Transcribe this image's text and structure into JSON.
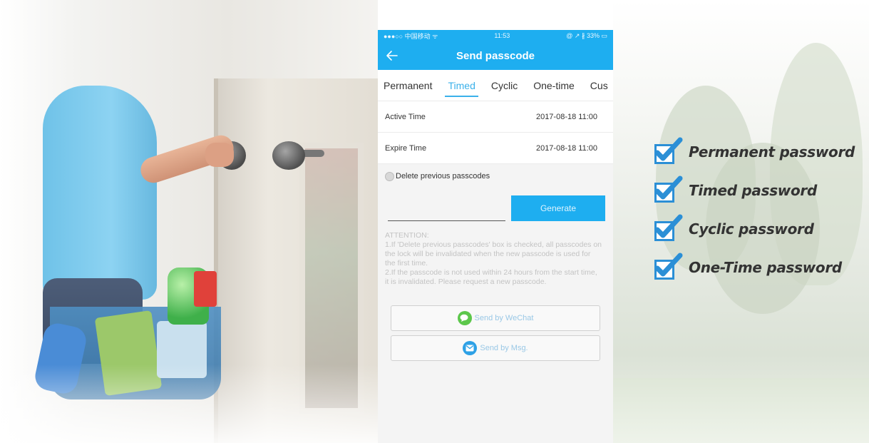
{
  "status_bar": {
    "carrier": "●●●○○ 中国移动 ᯤ",
    "time": "11:53",
    "right": "@ ↗ ∦ 33% ▭"
  },
  "app_bar": {
    "title": "Send passcode",
    "back_icon": "back-arrow-icon"
  },
  "tabs": [
    {
      "label": "Permanent",
      "active": false
    },
    {
      "label": "Timed",
      "active": true
    },
    {
      "label": "Cyclic",
      "active": false
    },
    {
      "label": "One-time",
      "active": false
    },
    {
      "label": "Cus",
      "active": false
    }
  ],
  "active_time": {
    "label": "Active Time",
    "value": "2017-08-18 11:00"
  },
  "expire_time": {
    "label": "Expire Time",
    "value": "2017-08-18 11:00"
  },
  "delete_previous": {
    "label": "Delete previous passcodes",
    "checked": false
  },
  "generate": {
    "label": "Generate",
    "input_value": ""
  },
  "attention": {
    "title": "ATTENTION:",
    "line1": "1.If 'Delete previous passcodes' box is checked, all passcodes on the lock will be invalidated when the new passcode is used for the first time.",
    "line2": "2.If the passcode is not used within 24 hours from the start time, it is invalidated. Please request a new passcode."
  },
  "send_buttons": {
    "wechat": "Send by WeChat",
    "msg": "Send by Msg."
  },
  "features": [
    "Permanent password",
    "Timed password",
    "Cyclic password",
    "One-Time password"
  ],
  "colors": {
    "accent": "#1eaef0",
    "check": "#2b8fd6",
    "wechat": "#5cc74b"
  }
}
